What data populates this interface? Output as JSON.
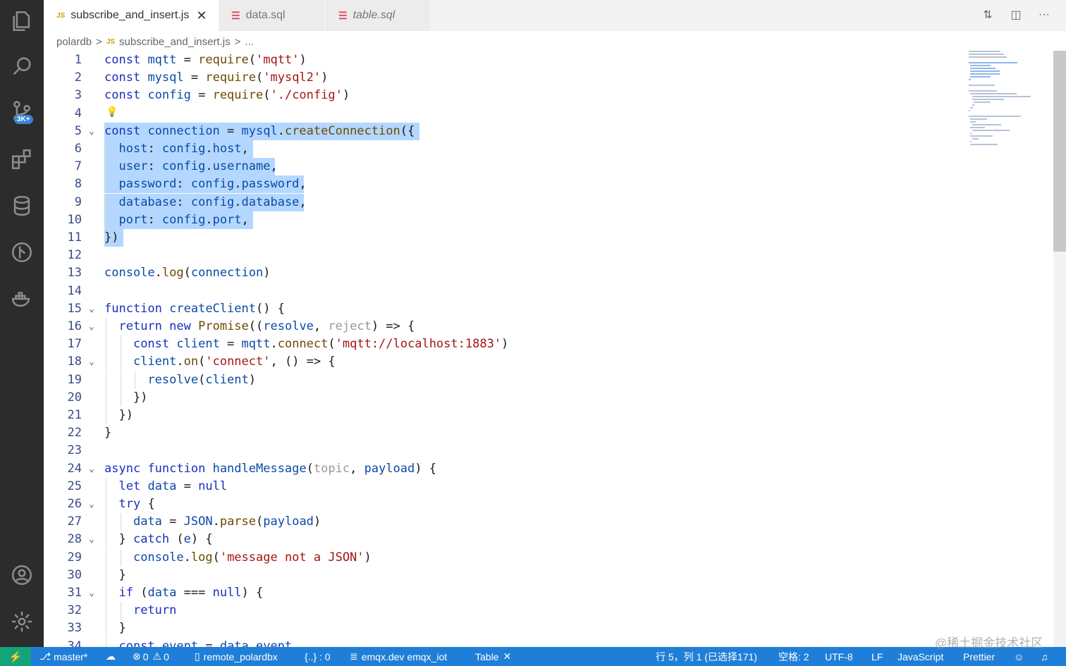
{
  "tabs": [
    {
      "icon": "JS",
      "label": "subscribe_and_insert.js",
      "close": "✕"
    },
    {
      "label": "data.sql"
    },
    {
      "label": "table.sql"
    }
  ],
  "breadcrumb": {
    "folder": "polardb",
    "sep": ">",
    "file_icon": "JS",
    "file": "subscribe_and_insert.js",
    "more": "..."
  },
  "activity": {
    "badge": "3K+"
  },
  "lines": [
    {
      "n": "1",
      "code": "const mqtt = require('mqtt')"
    },
    {
      "n": "2",
      "code": "const mysql = require('mysql2')"
    },
    {
      "n": "3",
      "code": "const config = require('./config')"
    },
    {
      "n": "4",
      "code": ""
    },
    {
      "n": "5",
      "code": "const connection = mysql.createConnection({"
    },
    {
      "n": "6",
      "code": "  host: config.host,"
    },
    {
      "n": "7",
      "code": "  user: config.username,"
    },
    {
      "n": "8",
      "code": "  password: config.password,"
    },
    {
      "n": "9",
      "code": "  database: config.database,"
    },
    {
      "n": "10",
      "code": "  port: config.port,"
    },
    {
      "n": "11",
      "code": "})"
    },
    {
      "n": "12",
      "code": ""
    },
    {
      "n": "13",
      "code": "console.log(connection)"
    },
    {
      "n": "14",
      "code": ""
    },
    {
      "n": "15",
      "code": "function createClient() {"
    },
    {
      "n": "16",
      "code": "  return new Promise((resolve, reject) => {"
    },
    {
      "n": "17",
      "code": "    const client = mqtt.connect('mqtt://localhost:1883')"
    },
    {
      "n": "18",
      "code": "    client.on('connect', () => {"
    },
    {
      "n": "19",
      "code": "      resolve(client)"
    },
    {
      "n": "20",
      "code": "    })"
    },
    {
      "n": "21",
      "code": "  })"
    },
    {
      "n": "22",
      "code": "}"
    },
    {
      "n": "23",
      "code": ""
    },
    {
      "n": "24",
      "code": "async function handleMessage(topic, payload) {"
    },
    {
      "n": "25",
      "code": "  let data = null"
    },
    {
      "n": "26",
      "code": "  try {"
    },
    {
      "n": "27",
      "code": "    data = JSON.parse(payload)"
    },
    {
      "n": "28",
      "code": "  } catch (e) {"
    },
    {
      "n": "29",
      "code": "    console.log('message not a JSON')"
    },
    {
      "n": "30",
      "code": "  }"
    },
    {
      "n": "31",
      "code": "  if (data === null) {"
    },
    {
      "n": "32",
      "code": "    return"
    },
    {
      "n": "33",
      "code": "  }"
    },
    {
      "n": "34",
      "code": "  const event = data.event"
    }
  ],
  "status": {
    "branch": "master*",
    "errors": "0",
    "warnings": "0",
    "remote": "remote_polardbx",
    "json": "{..} : 0",
    "db": "emqx.dev  emqx_iot",
    "table": "Table",
    "cursor": "行 5，列 1 (已选择171)",
    "spaces": "空格: 2",
    "encoding": "UTF-8",
    "eol": "LF",
    "language": "JavaScript",
    "formatter": "Prettier"
  },
  "watermark": "@稀土掘金技术社区",
  "colors": {
    "statusbar": "#1f7fd8",
    "selection": "#b4d7ff",
    "activitybar": "#2c2c2c"
  }
}
